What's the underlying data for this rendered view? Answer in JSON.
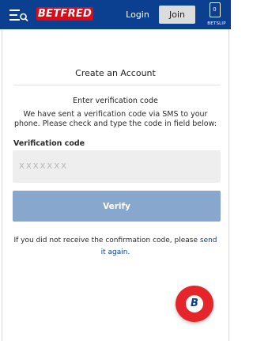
{
  "header": {
    "logo_text": "BETFRED",
    "login_label": "Login",
    "join_label": "Join",
    "betslip_count": "0",
    "betslip_label": "BETSLIP",
    "icons": {
      "menu": "menu-search-icon",
      "betslip": "betslip-icon"
    }
  },
  "page": {
    "title": "Create an Account",
    "section_title": "Enter verification code",
    "info_text": "We have sent a verification code via SMS to your phone. Please check and type the code in field below:",
    "field_label": "Verification code",
    "field_placeholder": "XXXXXXX",
    "field_value": "",
    "verify_label": "Verify",
    "resend_text": "If you did not receive the confirmation code, please",
    "resend_link": "send it again",
    "resend_suffix": "."
  },
  "fab": {
    "letter": "B",
    "icon": "betfred-chat-icon"
  },
  "colors": {
    "header_bg": "#0b3f8f",
    "brand_red": "#e30613",
    "button_disabled": "#88a7cc",
    "link": "#0b3f8f"
  }
}
